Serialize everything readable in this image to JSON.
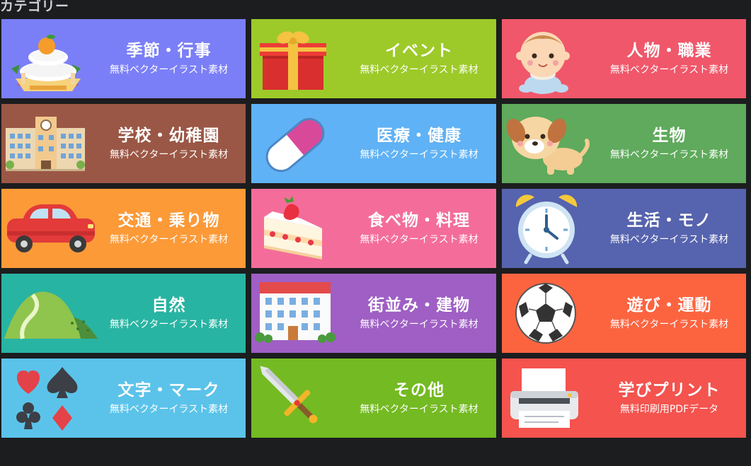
{
  "section": {
    "title": "カテゴリー"
  },
  "colors": {
    "page_background": "#1c1d1f",
    "text": "#ffffff"
  },
  "categories": [
    {
      "title": "季節・行事",
      "subtitle": "無料ベクターイラスト素材",
      "color": "#7b7ff7",
      "icon": "kagami-mochi-icon"
    },
    {
      "title": "イベント",
      "subtitle": "無料ベクターイラスト素材",
      "color": "#9dca28",
      "icon": "gift-box-icon"
    },
    {
      "title": "人物・職業",
      "subtitle": "無料ベクターイラスト素材",
      "color": "#f0576a",
      "icon": "baby-icon"
    },
    {
      "title": "学校・幼稚園",
      "subtitle": "無料ベクターイラスト素材",
      "color": "#9b5745",
      "icon": "school-building-icon"
    },
    {
      "title": "医療・健康",
      "subtitle": "無料ベクターイラスト素材",
      "color": "#5fb2f5",
      "icon": "capsule-icon"
    },
    {
      "title": "生物",
      "subtitle": "無料ベクターイラスト素材",
      "color": "#5faa5c",
      "icon": "puppy-icon"
    },
    {
      "title": "交通・乗り物",
      "subtitle": "無料ベクターイラスト素材",
      "color": "#fc9a38",
      "icon": "car-icon"
    },
    {
      "title": "食べ物・料理",
      "subtitle": "無料ベクターイラスト素材",
      "color": "#f46d9a",
      "icon": "cake-icon"
    },
    {
      "title": "生活・モノ",
      "subtitle": "無料ベクターイラスト素材",
      "color": "#5663ae",
      "icon": "alarm-clock-icon"
    },
    {
      "title": "自然",
      "subtitle": "無料ベクターイラスト素材",
      "color": "#28b4a2",
      "icon": "hills-icon"
    },
    {
      "title": "街並み・建物",
      "subtitle": "無料ベクターイラスト素材",
      "color": "#9f5fc4",
      "icon": "building-icon"
    },
    {
      "title": "遊び・運動",
      "subtitle": "無料ベクターイラスト素材",
      "color": "#fc6440",
      "icon": "soccer-ball-icon"
    },
    {
      "title": "文字・マーク",
      "subtitle": "無料ベクターイラスト素材",
      "color": "#5bc3ea",
      "icon": "card-suits-icon"
    },
    {
      "title": "その他",
      "subtitle": "無料ベクターイラスト素材",
      "color": "#74ba22",
      "icon": "sword-icon"
    },
    {
      "title": "学びプリント",
      "subtitle": "無料印刷用PDFデータ",
      "color": "#f4534e",
      "icon": "printer-icon"
    }
  ]
}
